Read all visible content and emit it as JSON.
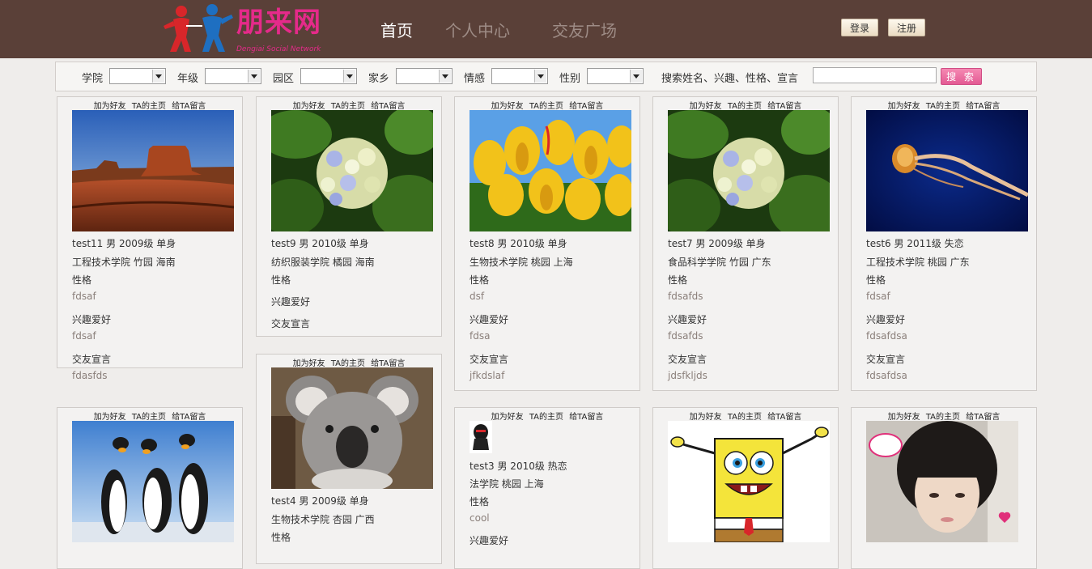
{
  "header": {
    "logo_title": "朋来网",
    "logo_subtitle": "Dengiai Social Network",
    "nav": [
      {
        "label": "首页",
        "active": true
      },
      {
        "label": "个人中心",
        "active": false
      },
      {
        "label": "交友广场",
        "active": false
      }
    ],
    "login_label": "登录",
    "register_label": "注册",
    "colors": {
      "bar": "#5a4038",
      "brand": "#e52a8a"
    }
  },
  "filters": {
    "fields": [
      {
        "label": "学院",
        "value": ""
      },
      {
        "label": "年级",
        "value": ""
      },
      {
        "label": "园区",
        "value": ""
      },
      {
        "label": "家乡",
        "value": ""
      },
      {
        "label": "情感",
        "value": ""
      },
      {
        "label": "性别",
        "value": ""
      }
    ],
    "search_label": "搜索姓名、兴趣、性格、宣言",
    "search_value": "",
    "search_button": "搜 索"
  },
  "card_actions": {
    "add_friend": "加为好友",
    "homepage": "TA的主页",
    "message": "给TA留言"
  },
  "profile_labels": {
    "personality": "性格",
    "hobby": "兴趣爱好",
    "declaration": "交友宣言"
  },
  "cards": [
    {
      "name_line": "test11 男 2009级 单身",
      "school_line": "工程技术学院 竹园 海南",
      "personality": "fdsaf",
      "hobby": "fdsaf",
      "declaration": "fdasfds",
      "photo": "desert-mesa"
    },
    {
      "name_line": "test9 男 2010级 单身",
      "school_line": "纺织服装学院 橘园 海南",
      "personality": "",
      "hobby": "",
      "declaration": "",
      "photo": "hydrangea-flowers"
    },
    {
      "name_line": "test8 男 2010级 单身",
      "school_line": "生物技术学院 桃园 上海",
      "personality": "dsf",
      "hobby": "fdsa",
      "declaration": "jfkdslaf",
      "photo": "yellow-tulips"
    },
    {
      "name_line": "test7 男 2009级 单身",
      "school_line": "食品科学学院 竹园 广东",
      "personality": "fdsafds",
      "hobby": "fdsafds",
      "declaration": "jdsfkljds",
      "photo": "hydrangea-flowers"
    },
    {
      "name_line": "test6 男 2011级 失恋",
      "school_line": "工程技术学院 桃园 广东",
      "personality": "fdsaf",
      "hobby": "fdsafdsa",
      "declaration": "fdsafdsa",
      "photo": "jellyfish"
    },
    {
      "name_line": "",
      "school_line": "",
      "personality": "",
      "hobby": "",
      "declaration": "",
      "photo": "penguins"
    },
    {
      "name_line": "test4 男 2009级 单身",
      "school_line": "生物技术学院 杏园 广西",
      "personality": "",
      "hobby": "",
      "declaration": "",
      "photo": "koala"
    },
    {
      "name_line": "test3 男 2010级 热恋",
      "school_line": "法学院 桃园 上海",
      "personality": "cool",
      "hobby": "",
      "declaration": "",
      "photo": "small-avatar"
    },
    {
      "name_line": "",
      "school_line": "",
      "personality": "",
      "hobby": "",
      "declaration": "",
      "photo": "cartoon-sponge"
    },
    {
      "name_line": "",
      "school_line": "",
      "personality": "",
      "hobby": "",
      "declaration": "",
      "photo": "girl-portrait"
    }
  ]
}
